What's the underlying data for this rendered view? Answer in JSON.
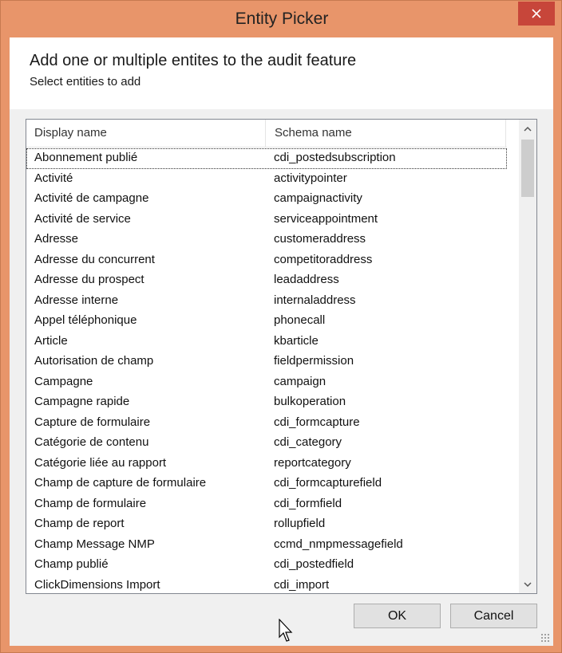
{
  "window": {
    "title": "Entity Picker"
  },
  "header": {
    "title": "Add one or multiple entites to the audit feature",
    "subtitle": "Select entities to add"
  },
  "list": {
    "columns": [
      "Display name",
      "Schema name"
    ],
    "rows": [
      {
        "display": "Abonnement publié",
        "schema": "cdi_postedsubscription"
      },
      {
        "display": "Activité",
        "schema": "activitypointer"
      },
      {
        "display": "Activité de campagne",
        "schema": "campaignactivity"
      },
      {
        "display": "Activité de service",
        "schema": "serviceappointment"
      },
      {
        "display": "Adresse",
        "schema": "customeraddress"
      },
      {
        "display": "Adresse du concurrent",
        "schema": "competitoraddress"
      },
      {
        "display": "Adresse du prospect",
        "schema": "leadaddress"
      },
      {
        "display": "Adresse interne",
        "schema": "internaladdress"
      },
      {
        "display": "Appel téléphonique",
        "schema": "phonecall"
      },
      {
        "display": "Article",
        "schema": "kbarticle"
      },
      {
        "display": "Autorisation de champ",
        "schema": "fieldpermission"
      },
      {
        "display": "Campagne",
        "schema": "campaign"
      },
      {
        "display": "Campagne rapide",
        "schema": "bulkoperation"
      },
      {
        "display": "Capture de formulaire",
        "schema": "cdi_formcapture"
      },
      {
        "display": "Catégorie de contenu",
        "schema": "cdi_category"
      },
      {
        "display": "Catégorie liée au rapport",
        "schema": "reportcategory"
      },
      {
        "display": "Champ de capture de formulaire",
        "schema": "cdi_formcapturefield"
      },
      {
        "display": "Champ de formulaire",
        "schema": "cdi_formfield"
      },
      {
        "display": "Champ de report",
        "schema": "rollupfield"
      },
      {
        "display": "Champ Message NMP",
        "schema": "ccmd_nmpmessagefield"
      },
      {
        "display": "Champ publié",
        "schema": "cdi_postedfield"
      },
      {
        "display": "ClickDimensions Import",
        "schema": "cdi_import"
      }
    ]
  },
  "buttons": {
    "ok": "OK",
    "cancel": "Cancel"
  },
  "icons": {
    "close": "close-icon",
    "scroll_up": "chevron-up-icon",
    "scroll_down": "chevron-down-icon"
  },
  "colors": {
    "frame": "#e8956a",
    "close": "#c7463a"
  }
}
